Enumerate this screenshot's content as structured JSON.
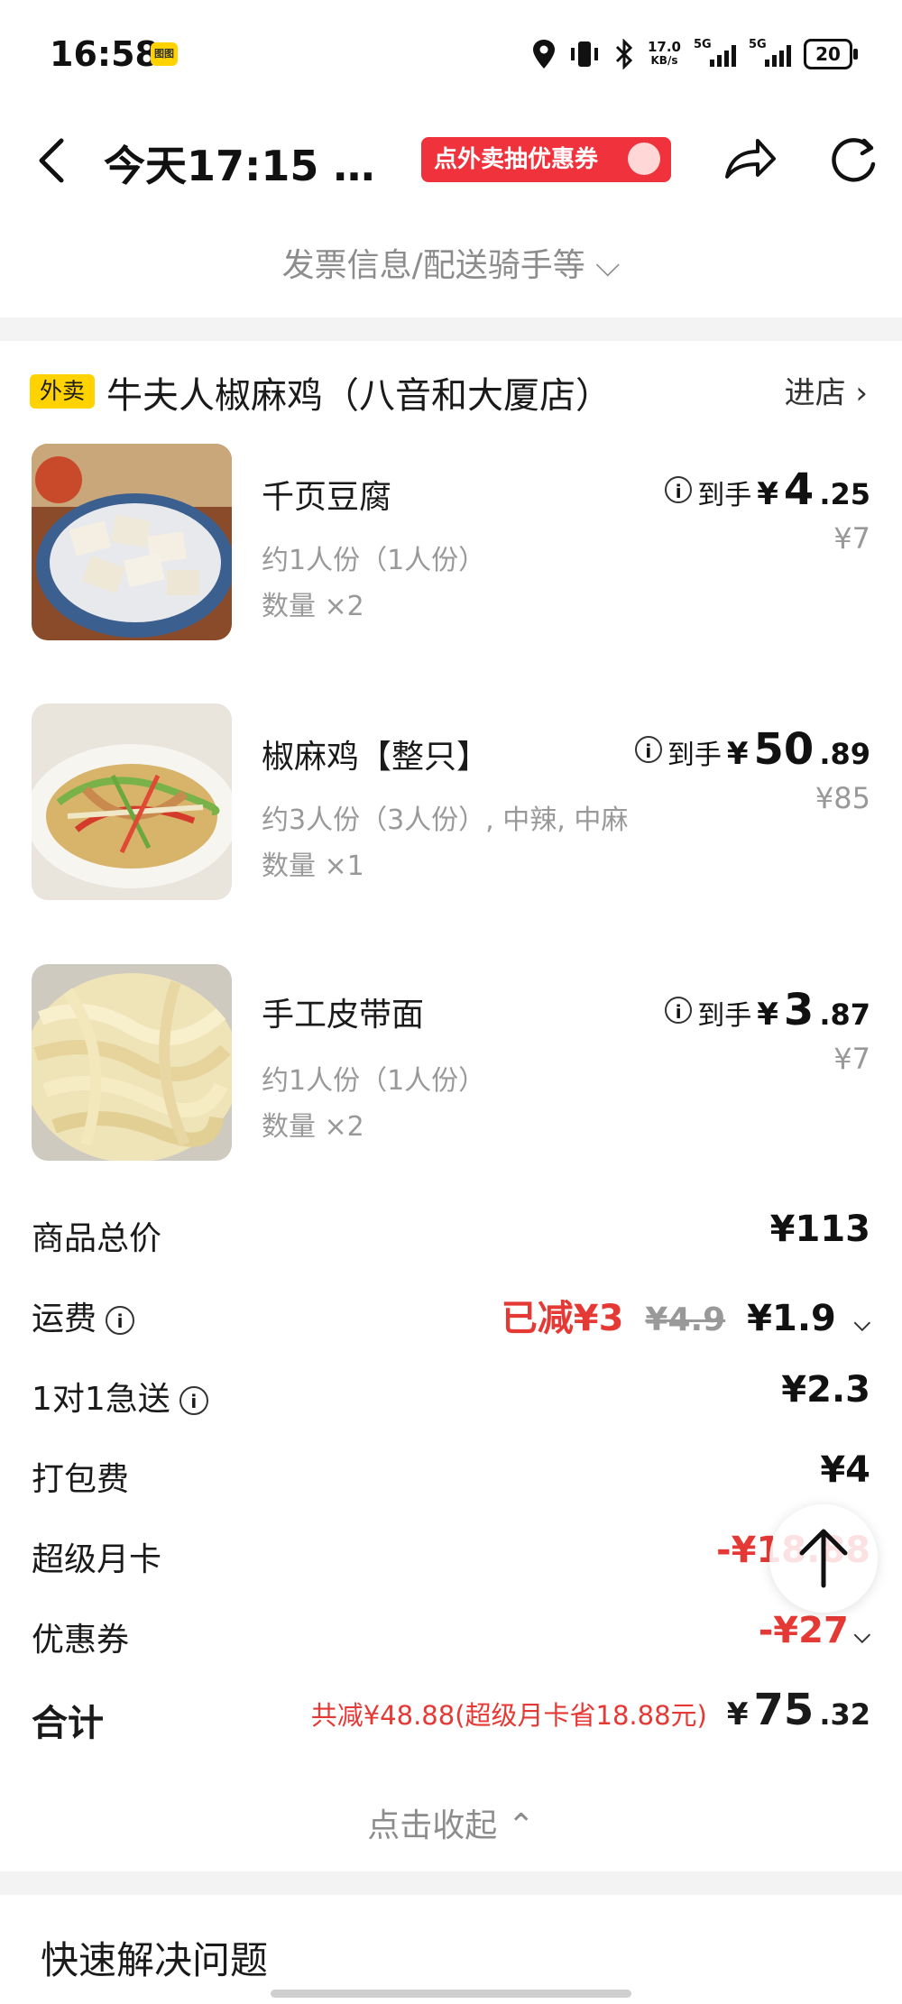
{
  "status": {
    "time": "16:58",
    "badge": "图图",
    "net_speed": "17.0",
    "net_unit": "KB/s",
    "sig1": "5G",
    "sig2": "5G",
    "battery": "20"
  },
  "header": {
    "title": "今天17:15 …",
    "promo": "点外卖抽优惠券",
    "sub_link": "发票信息/配送骑手等 ⌵"
  },
  "store": {
    "tag": "外卖",
    "name": "牛夫人椒麻鸡（八音和大厦店）",
    "enter": "进店 ›"
  },
  "items": [
    {
      "name": "千页豆腐",
      "spec": "约1人份（1人份）",
      "qty": "数量 ×2",
      "label": "到手",
      "yen": "¥",
      "int": "4",
      "dec": ".25",
      "orig": "¥7"
    },
    {
      "name": "椒麻鸡【整只】",
      "spec": "约3人份（3人份）, 中辣, 中麻",
      "qty": "数量 ×1",
      "label": "到手",
      "yen": "¥",
      "int": "50",
      "dec": ".89",
      "orig": "¥85"
    },
    {
      "name": "手工皮带面",
      "spec": "约1人份（1人份）",
      "qty": "数量 ×2",
      "label": "到手",
      "yen": "¥",
      "int": "3",
      "dec": ".87",
      "orig": "¥7"
    }
  ],
  "summary": {
    "goods_label": "商品总价",
    "goods_value": "¥113",
    "delivery_label": "运费",
    "delivery_discount": "已减¥3",
    "delivery_orig": "¥4.9",
    "delivery_value": "¥1.9",
    "express_label": "1对1急送",
    "express_value": "¥2.3",
    "pack_label": "打包费",
    "pack_value": "¥4",
    "card_label": "超级月卡",
    "card_value": "-¥18.88",
    "coupon_label": "优惠券",
    "coupon_value": "-¥27",
    "total_label": "合计",
    "total_note": "共减¥48.88(超级月卡省18.88元)",
    "total_yen": "¥",
    "total_int": "75",
    "total_dec": ".32"
  },
  "collapse": "点击收起 ⌃",
  "quick_title": "快速解决问题",
  "colors": {
    "accent_red": "#e53935",
    "tag_yellow": "#ffd200",
    "promo_red": "#f0323c"
  }
}
